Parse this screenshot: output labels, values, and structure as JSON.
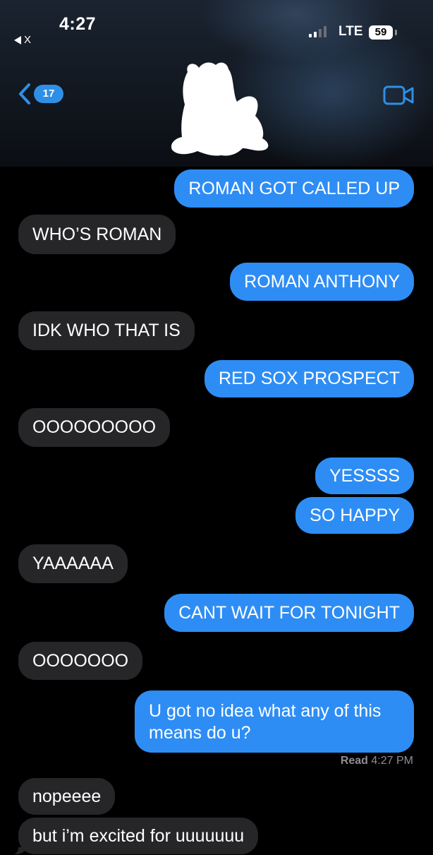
{
  "status_bar": {
    "time": "4:27",
    "back_app_label": "X",
    "network": "LTE",
    "battery": "59"
  },
  "nav": {
    "unread_count": "17"
  },
  "messages": [
    {
      "dir": "out",
      "text": "ROMAN GOT CALLED UP"
    },
    {
      "dir": "in",
      "text": "WHO’S ROMAN"
    },
    {
      "dir": "out",
      "text": "ROMAN ANTHONY"
    },
    {
      "dir": "in",
      "text": "IDK WHO THAT IS"
    },
    {
      "dir": "out",
      "text": "RED SOX PROSPECT"
    },
    {
      "dir": "in",
      "text": "OOOOOOOOO"
    },
    {
      "dir": "out",
      "text": "YESSSS"
    },
    {
      "dir": "out",
      "text": "SO HAPPY"
    },
    {
      "dir": "in",
      "text": "YAAAAAA"
    },
    {
      "dir": "out",
      "text": "CANT WAIT FOR TONIGHT"
    },
    {
      "dir": "in",
      "text": "OOOOOOO"
    },
    {
      "dir": "out",
      "text": "U got no idea what any of this means do u?"
    },
    {
      "dir": "in",
      "text": "nopeeee"
    },
    {
      "dir": "in",
      "text": "but i’m excited for uuuuuuu"
    }
  ],
  "read_receipt": {
    "label": "Read",
    "time": "4:27 PM"
  },
  "colors": {
    "outgoing_bubble": "#2e8df4",
    "incoming_bubble": "#262628",
    "background": "#000000",
    "accent": "#2f8fe6"
  }
}
